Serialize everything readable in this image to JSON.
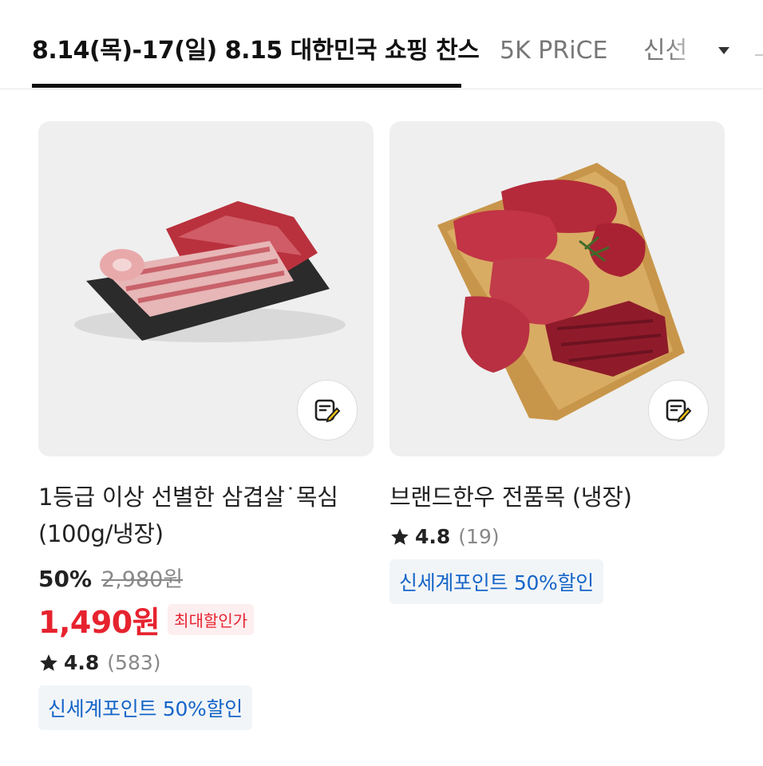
{
  "tabs": {
    "active": "8.14(목)-17(일) 8.15 대한민국 쇼핑 찬스",
    "second": "5K PRiCE",
    "third": "신선"
  },
  "icons": {
    "more": "chevron-down-icon",
    "review": "write-review-icon",
    "star": "star-icon"
  },
  "colors": {
    "price_red": "#e6232f",
    "point_blue": "#1565c8"
  },
  "products": [
    {
      "title": "1등급 이상 선별한 삼겹살˙목심 (100g/냉장)",
      "discount": "50%",
      "original_price": "2,980원",
      "final_price": "1,490원",
      "badge": "최대할인가",
      "rating": "4.8",
      "review_count": "(583)",
      "benefit": "신세계포인트 50%할인"
    },
    {
      "title": "브랜드한우 전품목 (냉장)",
      "rating": "4.8",
      "review_count": "(19)",
      "benefit": "신세계포인트 50%할인"
    }
  ]
}
